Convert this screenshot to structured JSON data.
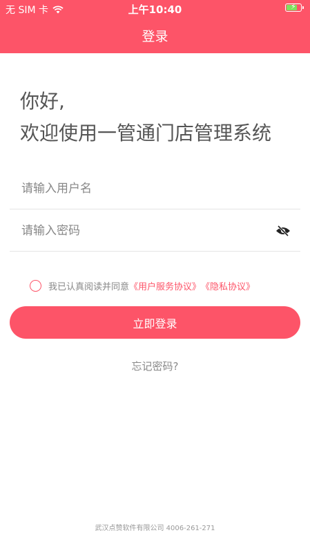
{
  "status_bar": {
    "carrier": "无 SIM 卡",
    "wifi_icon": "wifi-icon",
    "time": "上午10:40",
    "battery_icon": "battery-charging-icon",
    "battery_color": "#7ee25e"
  },
  "header": {
    "title": "登录",
    "background_color": "#fd5468"
  },
  "welcome": {
    "line1": "你好,",
    "line2": "欢迎使用一管通门店管理系统"
  },
  "form": {
    "username_placeholder": "请输入用户名",
    "username_value": "",
    "password_placeholder": "请输入密码",
    "password_value": "",
    "password_toggle_icon": "eye-hidden-icon"
  },
  "agreement": {
    "text": "我已认真阅读并同意",
    "user_agreement_link": "《用户服务协议》",
    "privacy_link": "《隐私协议》",
    "checked": false
  },
  "login_button": "立即登录",
  "forgot_password": "忘记密码?",
  "footer": "武汉点赞软件有限公司 4006-261-271"
}
